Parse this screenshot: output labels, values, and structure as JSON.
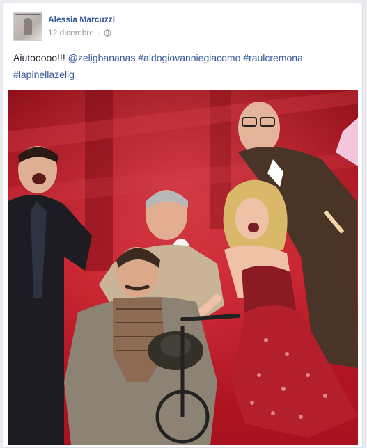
{
  "post": {
    "author": "Alessia Marcuzzi",
    "date": "12 dicembre",
    "audience_icon": "globe-icon",
    "text_plain": "Aiutooooo!!! ",
    "mention": "@zeligbananas",
    "hashtags": [
      "#aldogiovanniegiacomo",
      "#raulcremona",
      "#lapinellazelig"
    ]
  },
  "colors": {
    "link": "#365899",
    "text": "#1d2129",
    "meta": "#90949c",
    "stage_red": "#b01522"
  }
}
